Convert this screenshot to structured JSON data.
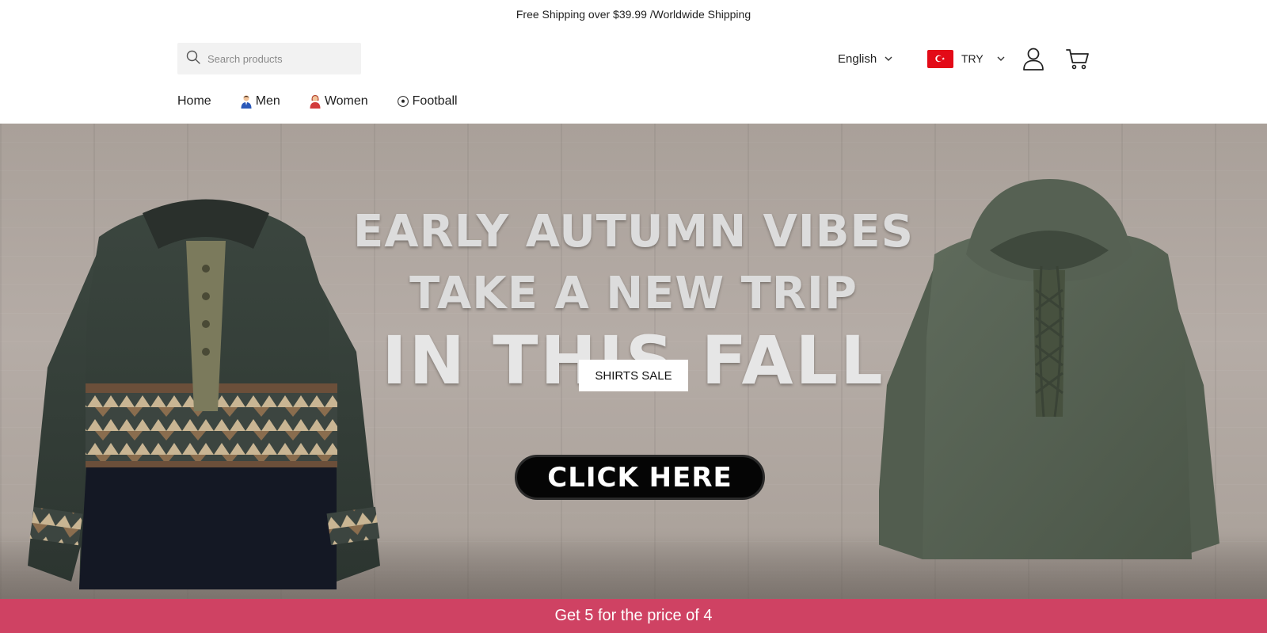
{
  "announcement": "Free Shipping over $39.99 /Worldwide Shipping",
  "search": {
    "placeholder": "Search products",
    "icon": "search-icon"
  },
  "language": {
    "label": "English"
  },
  "currency": {
    "code": "TRY",
    "flag": "turkey-flag-icon"
  },
  "header_icons": {
    "account": "account-icon",
    "cart": "cart-icon"
  },
  "nav": {
    "items": [
      {
        "label": "Home",
        "emoji": ""
      },
      {
        "label": " Men",
        "emoji": "man-emoji-icon"
      },
      {
        "label": "Women",
        "emoji": "woman-emoji-icon"
      },
      {
        "label": "Football",
        "emoji": "soccer-ball-emoji-icon"
      }
    ]
  },
  "hero": {
    "line1": "EARLY AUTUMN VIBES",
    "line2": "TAKE A NEW TRIP",
    "line3": "IN THIS FALL",
    "button": "SHIRTS SALE",
    "cta": "CLICK HERE"
  },
  "promo": "Get 5 for the price of 4",
  "colors": {
    "promo_bg": "#cf4263",
    "flag_red": "#e30a17",
    "search_bg": "#f2f2f2"
  }
}
